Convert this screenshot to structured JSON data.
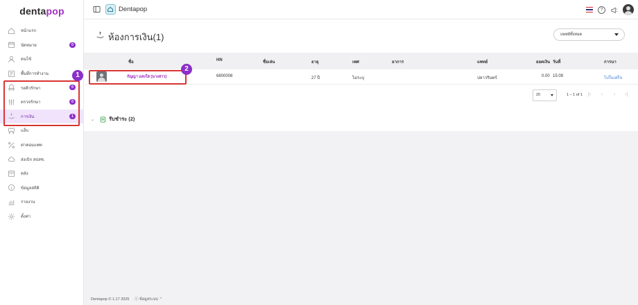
{
  "brand": {
    "part1": "denta",
    "part2": "pop"
  },
  "topbar": {
    "app_title": "Dentapop",
    "help_glyph": "?"
  },
  "sidebar": {
    "items": [
      {
        "label": "หน้าแรก",
        "icon": "home-icon",
        "badge": ""
      },
      {
        "label": "นัดหมาย",
        "icon": "calendar-icon",
        "badge": "0"
      },
      {
        "label": "คนไข้",
        "icon": "user-icon",
        "badge": ""
      },
      {
        "label": "พื้นที่การทำงาน",
        "icon": "workspace-icon",
        "badge": ""
      },
      {
        "label": "รอคิวรักษา",
        "icon": "dental-chair-icon",
        "badge": "0"
      },
      {
        "label": "ตรวจรักษา",
        "icon": "tools-icon",
        "badge": "0"
      },
      {
        "label": "การเงิน",
        "icon": "hand-money-icon",
        "badge": "1"
      },
      {
        "label": "แล็บ",
        "icon": "tooth-icon",
        "badge": ""
      },
      {
        "label": "ค่าคอมแพท",
        "icon": "percent-icon",
        "badge": ""
      },
      {
        "label": "ส่งเบิก สปสช.",
        "icon": "cloud-icon",
        "badge": ""
      },
      {
        "label": "คลัง",
        "icon": "box-icon",
        "badge": ""
      },
      {
        "label": "ข้อมูลสถิติ",
        "icon": "info-icon",
        "badge": ""
      },
      {
        "label": "รายงาน",
        "icon": "chart-icon",
        "badge": ""
      },
      {
        "label": "ตั้งค่า",
        "icon": "gear-icon",
        "badge": ""
      }
    ]
  },
  "annotations": {
    "one": "1",
    "two": "2"
  },
  "page": {
    "title": "ห้องการเงิน(1)",
    "doctor_filter": "แพทย์ทั้งหมด"
  },
  "table": {
    "headers": {
      "name": "ชื่อ",
      "hn": "HN",
      "nickname": "ชื่อเล่น",
      "age": "อายุ",
      "sex": "เพศ",
      "symptom": "อาการ",
      "doctor": "แพทย์",
      "amount": "ยอดเงิน",
      "date": "วันที่",
      "action": "การนา"
    },
    "rows": [
      {
        "name": "กัญญา แสงใส [นางสาว]",
        "hn": "6800008",
        "nickname": "",
        "age": "27 ปี",
        "sex": "ไม่ระบุ",
        "symptom": "",
        "doctor": "ปลาวรินทร์",
        "amount": "0.00",
        "date": "15:09",
        "action": "ไปใบเสร็จ"
      }
    ]
  },
  "pager": {
    "rows_per_page": "20",
    "range": "1 – 1 of 1"
  },
  "section": {
    "paid_label": "รับชำระ (2)"
  },
  "footer": {
    "text": "Dentapop © 1.17 2025",
    "info_label": "ข้อมูลระบบ"
  }
}
